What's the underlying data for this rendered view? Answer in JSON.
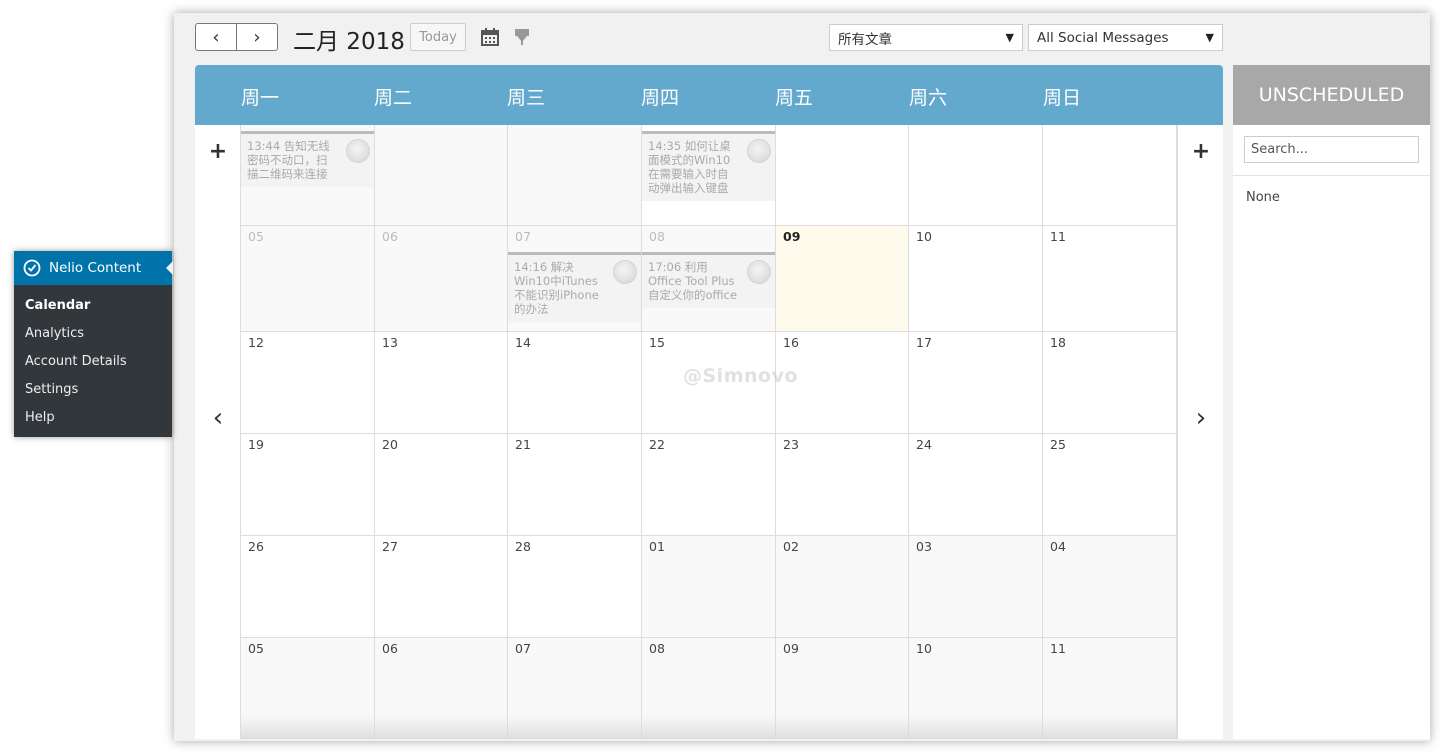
{
  "toolbar": {
    "prev_icon": "chevron-left-icon",
    "next_icon": "chevron-right-icon",
    "prev_glyph": "‹",
    "next_glyph": "›",
    "month_title": "二月 2018",
    "today_label": "Today",
    "calendar_icon": "calendar-icon",
    "download_icon": "download-icon",
    "post_filter": "所有文章",
    "social_filter": "All Social Messages"
  },
  "weekdays": [
    "周一",
    "周二",
    "周三",
    "周四",
    "周五",
    "周六",
    "周日"
  ],
  "weeks": [
    [
      "",
      "",
      "",
      "",
      "",
      "",
      ""
    ],
    [
      "05",
      "06",
      "07",
      "08",
      "09",
      "10",
      "11"
    ],
    [
      "12",
      "13",
      "14",
      "15",
      "16",
      "17",
      "18"
    ],
    [
      "19",
      "20",
      "21",
      "22",
      "23",
      "24",
      "25"
    ],
    [
      "26",
      "27",
      "28",
      "01",
      "02",
      "03",
      "04"
    ],
    [
      "05",
      "06",
      "07",
      "08",
      "09",
      "10",
      "11"
    ]
  ],
  "events": [
    {
      "text": "13:44 告知无线密码不动口，扫描二维码来连接"
    },
    {
      "text": "14:35 如何让桌面模式的Win10在需要输入时自动弹出输入键盘"
    },
    {
      "text": "14:16 解决Win10中iTunes不能识别iPhone的办法"
    },
    {
      "text": "17:06 利用Office Tool Plus自定义你的office"
    }
  ],
  "side": {
    "add_glyph": "+",
    "prev_glyph": "‹",
    "next_glyph": "›"
  },
  "watermark": "@Simnovo",
  "unscheduled": {
    "title": "UNSCHEDULED",
    "search_placeholder": "Search...",
    "empty_text": "None"
  },
  "wp_menu": {
    "title": "Nelio Content",
    "items": [
      "Calendar",
      "Analytics",
      "Account Details",
      "Settings",
      "Help"
    ]
  },
  "colors": {
    "header_blue": "#63a8cd",
    "unscheduled_gray": "#a8a8a8",
    "wp_menu_bg": "#32373c",
    "wp_menu_active": "#0073aa",
    "today_bg": "#fefbec"
  }
}
